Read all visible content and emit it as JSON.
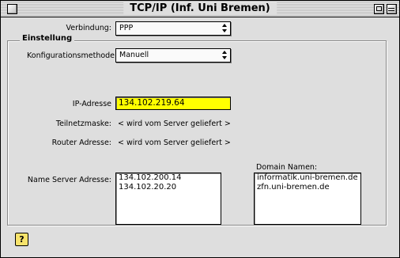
{
  "window": {
    "title": "TCP/IP (Inf. Uni Bremen)"
  },
  "connection": {
    "label": "Verbindung:",
    "value": "PPP"
  },
  "settings": {
    "group_title": "Einstellung",
    "config_method_label": "Konfigurationsmethode:",
    "config_method_value": "Manuell",
    "ip_label": "IP-Adresse",
    "ip_value": "134.102.219.64",
    "subnet_label": "Teilnetzmaske:",
    "subnet_value": "< wird vom Server geliefert >",
    "router_label": "Router Adresse:",
    "router_value": "< wird vom Server geliefert >",
    "nameserver_label": "Name Server Adresse:",
    "nameservers": [
      "134.102.200.14",
      "134.102.20.20"
    ],
    "domain_label": "Domain Namen:",
    "domains": [
      "informatik.uni-bremen.de",
      "zfn.uni-bremen.de"
    ]
  },
  "colors": {
    "ip_highlight": "#ffff00"
  },
  "icons": {
    "help": "help-question-icon"
  }
}
